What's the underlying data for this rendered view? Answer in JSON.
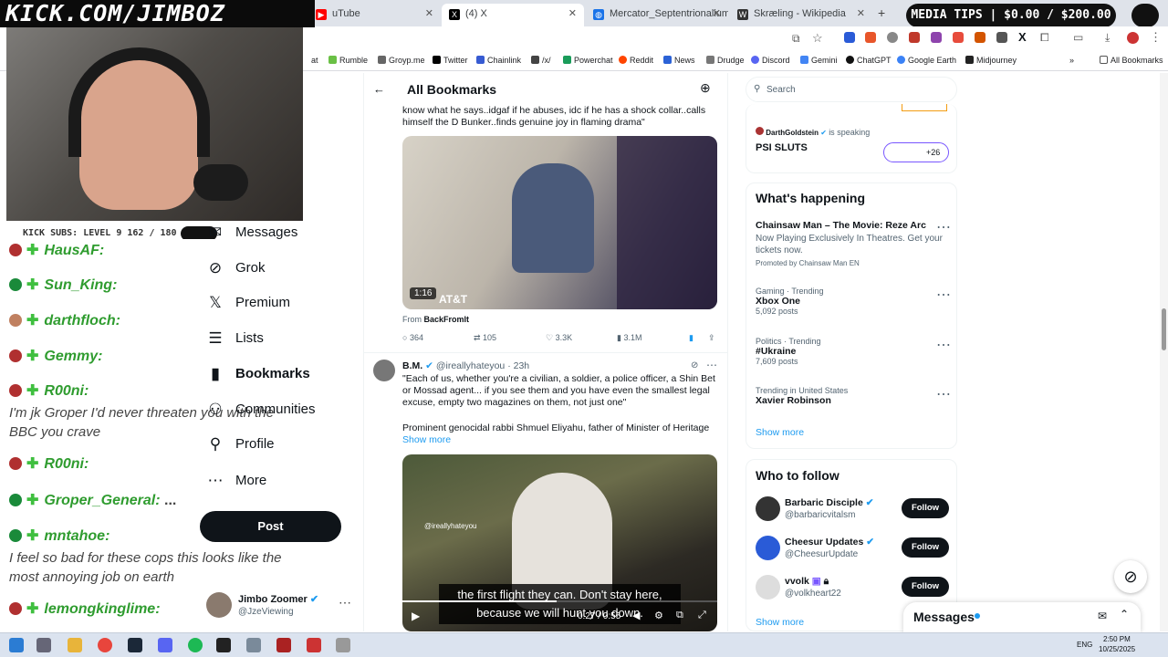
{
  "overlay": {
    "title": "KICK.COM/JIMBOZ",
    "media_tips": "MEDIA TIPS | $0.00 / $200.00",
    "subs": "KICK SUBS: LEVEL 9 162 / 180"
  },
  "tabs": [
    {
      "label": "uTube",
      "icon": "youtube-icon",
      "color": "#ff0000"
    },
    {
      "label": "(4) X",
      "icon": "x-icon",
      "color": "#000000"
    },
    {
      "label": "Mercator_Septentrionalium_Te",
      "icon": "globe-icon",
      "color": "#1a73e8"
    },
    {
      "label": "Skræling - Wikipedia",
      "icon": "wikipedia-icon",
      "color": "#333333"
    }
  ],
  "bookmarks": [
    "at",
    "Rumble",
    "Groyp.me",
    "Twitter",
    "Chainlink",
    "/x/",
    "Powerchat",
    "Reddit",
    "News",
    "Drudge",
    "Discord",
    "Gemini",
    "ChatGPT",
    "Google Earth",
    "Midjourney"
  ],
  "bookmarks_folder": "All Bookmarks",
  "chat": {
    "messages": [
      {
        "name": "HausAF:",
        "text": ""
      },
      {
        "name": "Sun_King:",
        "text": ""
      },
      {
        "name": "darthfloch:",
        "text": ""
      },
      {
        "name": "Gemmy:",
        "text": ""
      },
      {
        "name": "R00ni:",
        "text": "I'm jk Groper I'd never threaten you with the BBC you crave"
      },
      {
        "name": "R00ni:",
        "text": ""
      },
      {
        "name": "Groper_General:",
        "text": "..."
      },
      {
        "name": "mntahoe:",
        "text": "I feel so bad for these cops this looks like the most annoying job on earth"
      },
      {
        "name": "lemongkinglime:",
        "text": ""
      }
    ]
  },
  "nav": {
    "items": [
      {
        "label": "Messages",
        "icon": "mail-icon"
      },
      {
        "label": "Grok",
        "icon": "grok-icon"
      },
      {
        "label": "Premium",
        "icon": "x-icon"
      },
      {
        "label": "Lists",
        "icon": "list-icon"
      },
      {
        "label": "Bookmarks",
        "icon": "bookmark-icon"
      },
      {
        "label": "Communities",
        "icon": "people-icon"
      },
      {
        "label": "Profile",
        "icon": "person-icon"
      },
      {
        "label": "More",
        "icon": "more-icon"
      }
    ],
    "post": "Post",
    "account": {
      "name": "Jimbo Zoomer",
      "handle": "@JzeViewing"
    }
  },
  "feed": {
    "header": "All Bookmarks",
    "tweet1": {
      "text": "know what he says..idgaf if he abuses, idc if he has a shock collar..calls himself the D Bunker..finds genuine joy in flaming drama\"",
      "duration": "1:16",
      "watermark": "AT&T",
      "source_prefix": "From",
      "source": "BackFromIt",
      "replies": "364",
      "reposts": "105",
      "likes": "3.3K",
      "views": "3.1M"
    },
    "tweet2": {
      "name": "B.M.",
      "handle": "@ireallyhateyou",
      "time": "· 23h",
      "text": "\"Each of us, whether you're a civilian, a soldier, a police officer, a Shin Bet or Mossad agent... if you see them and you have even the smallest legal excuse, empty two magazines on them, not just one\"",
      "text2": "Prominent genocidal rabbi Shmuel Eliyahu, father of Minister of Heritage",
      "show_more": "Show more",
      "video_handle": "@ireallyhateyou",
      "caption": "the first flight they can. Don't stay here, because we will hunt you down.",
      "time_display": "0:27 / 0:55"
    }
  },
  "right": {
    "search_placeholder": "Search",
    "space": {
      "host": "DarthGoldstein",
      "status": "is speaking",
      "title": "PSI SLUTS",
      "count": "+26"
    },
    "happening_title": "What's happening",
    "trends": [
      {
        "meta": "",
        "title": "Chainsaw Man – The Movie: Reze Arc",
        "desc": "Now Playing Exclusively In Theatres. Get your tickets now.",
        "posts": "Promoted by Chainsaw Man EN"
      },
      {
        "meta": "Gaming · Trending",
        "title": "Xbox One",
        "desc": "",
        "posts": "5,092 posts"
      },
      {
        "meta": "Politics · Trending",
        "title": "#Ukraine",
        "desc": "",
        "posts": "7,609 posts"
      },
      {
        "meta": "Trending in United States",
        "title": "Xavier Robinson",
        "desc": "",
        "posts": ""
      }
    ],
    "show_more": "Show more",
    "follow_title": "Who to follow",
    "follows": [
      {
        "name": "Barbaric Disciple",
        "handle": "@barbaricvitalsm",
        "button": "Follow"
      },
      {
        "name": "Cheesur Updates",
        "handle": "@CheesurUpdate",
        "button": "Follow"
      },
      {
        "name": "vvolk",
        "handle": "@volkheart22",
        "button": "Follow"
      }
    ],
    "follow_show_more": "Show more",
    "messages": "Messages"
  },
  "taskbar": {
    "lang": "ENG",
    "time": "2:50 PM",
    "date": "10/25/2025"
  }
}
